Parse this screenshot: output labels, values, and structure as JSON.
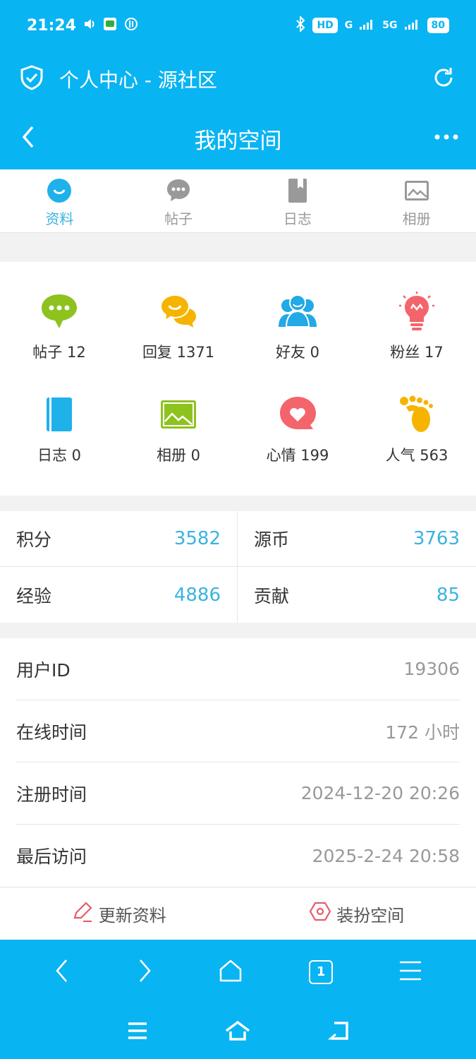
{
  "status_bar": {
    "time": "21:24",
    "network_hd": "HD",
    "network_g": "G",
    "network_5g": "5G",
    "battery": "80"
  },
  "browser": {
    "title": "个人中心 - 源社区"
  },
  "header": {
    "title": "我的空间"
  },
  "tabs": [
    {
      "label": "资料",
      "active": true,
      "icon": "smile-icon"
    },
    {
      "label": "帖子",
      "active": false,
      "icon": "chat-bubble-icon"
    },
    {
      "label": "日志",
      "active": false,
      "icon": "bookmark-icon"
    },
    {
      "label": "相册",
      "active": false,
      "icon": "image-icon"
    }
  ],
  "stats": [
    {
      "label": "帖子 12",
      "icon": "chat-dots-icon",
      "color": "#8dc21f"
    },
    {
      "label": "回复 1371",
      "icon": "reply-bubbles-icon",
      "color": "#f6b400"
    },
    {
      "label": "好友 0",
      "icon": "friends-icon",
      "color": "#22a9e6"
    },
    {
      "label": "粉丝 17",
      "icon": "lightbulb-icon",
      "color": "#f4646b"
    },
    {
      "label": "日志 0",
      "icon": "notebook-icon",
      "color": "#22a9e6"
    },
    {
      "label": "相册 0",
      "icon": "photo-icon",
      "color": "#8dc21f"
    },
    {
      "label": "心情 199",
      "icon": "heart-bubble-icon",
      "color": "#f4646b"
    },
    {
      "label": "人气 563",
      "icon": "footprint-icon",
      "color": "#f6b400"
    }
  ],
  "points": [
    {
      "label": "积分",
      "value": "3582"
    },
    {
      "label": "源币",
      "value": "3763"
    },
    {
      "label": "经验",
      "value": "4886"
    },
    {
      "label": "贡献",
      "value": "85"
    }
  ],
  "info": [
    {
      "label": "用户ID",
      "value": "19306"
    },
    {
      "label": "在线时间",
      "value": "172 小时"
    },
    {
      "label": "注册时间",
      "value": "2024-12-20 20:26"
    },
    {
      "label": "最后访问",
      "value": "2025-2-24 20:58"
    }
  ],
  "actions": {
    "update_profile": "更新资料",
    "decorate_space": "装扮空间"
  },
  "browser_nav": {
    "tab_count": "1"
  },
  "colors": {
    "primary": "#09b4f2",
    "accent_text": "#3ab3e0"
  }
}
